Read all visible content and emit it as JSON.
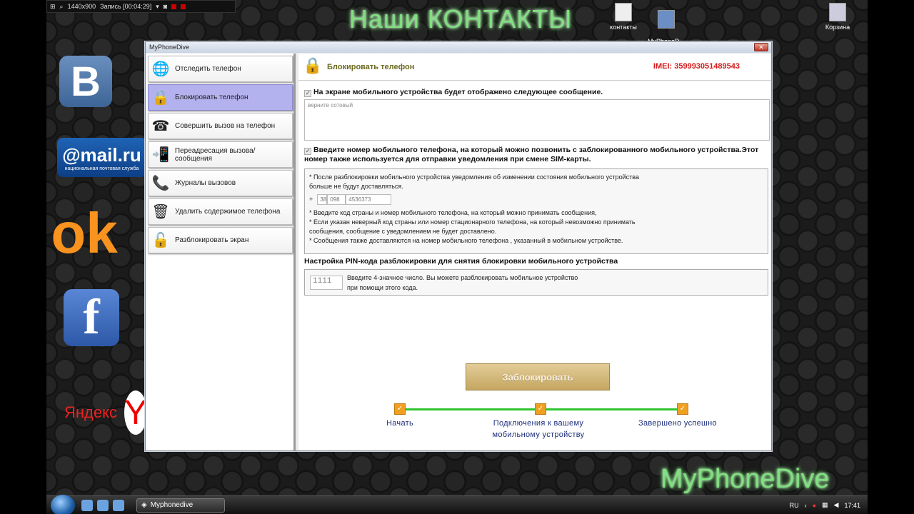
{
  "recorder": {
    "resolution": "1440x900",
    "status": "Запись [00:04:29]"
  },
  "desktop": {
    "title": "Наши КОНТАКТЫ",
    "brand": "MyPhoneDive",
    "icons": [
      {
        "label": "контакты"
      },
      {
        "label": "MyPhoneD...\n- Ярлык"
      },
      {
        "label": "Корзина"
      }
    ],
    "tiles": {
      "vk": "B",
      "mail": "@mail.ru",
      "mail_sub": "национальная почтовая служба",
      "ok": "ok",
      "fb": "f",
      "ya": "Яндекс"
    }
  },
  "window": {
    "title": "MyPhoneDive",
    "close": "✕",
    "sidebar": {
      "items": [
        {
          "label": "Отследить телефон",
          "icon": "globe-icon"
        },
        {
          "label": "Блокировать телефон",
          "icon": "lock-icon",
          "active": true
        },
        {
          "label": "Совершить вызов на телефон",
          "icon": "phone-icon"
        },
        {
          "label": "Переадресация вызова/сообщения",
          "icon": "forward-icon"
        },
        {
          "label": "Журналы вызовов",
          "icon": "phone-book-icon"
        },
        {
          "label": "Удалить содержимое телефона",
          "icon": "trash-icon"
        },
        {
          "label": "Разблокировать экран",
          "icon": "unlock-icon"
        }
      ]
    },
    "content": {
      "title": "Блокировать телефон",
      "imei": "IMEI: 359993051489543",
      "message_label": "На экране мобильного устройства будет отображено следующее сообщение.",
      "message_value": "верните сотовый",
      "phone_label": "Введите номер мобильного телефона, на который можно позвонить с заблокированного мобильного устройства.Этот номер также используется для отправки уведомления при смене SIM-карты.",
      "info": {
        "line1": "* После разблокировки мобильного устройства уведомления об изменении состояния мобильного устройства",
        "line2": "больше не будут доставляться.",
        "plus": "+",
        "country": "38",
        "code": "098",
        "number": "4536373",
        "line3": "* Введите код страны и номер мобильного телефона, на который можно принимать сообщения,",
        "line4": "* Если указан неверный код страны или номер стационарного телефона, на который невозможно принимать",
        "line5": "сообщения, сообщение с уведомлением не будет доставлено.",
        "line6": "* Сообщения также доставляются на номер мобильного телефона , указанный в мобильном устройстве."
      },
      "pin_label": "Настройка PIN-кода разблокировки для снятия блокировки мобильного устройства",
      "pin_value": "1111",
      "pin_note1": "Введите 4-значное число. Вы можете разблокировать мобильное устройство",
      "pin_note2": "при помощи этого кода.",
      "lock_button": "Заблокировать",
      "steps": {
        "start": "Начать",
        "connect1": "Подключения к вашему",
        "connect2": "мобильному устройству",
        "done": "Завершено успешно"
      }
    }
  },
  "taskbar": {
    "task": "Myphonedive",
    "lang": "RU",
    "time": "17:41"
  }
}
